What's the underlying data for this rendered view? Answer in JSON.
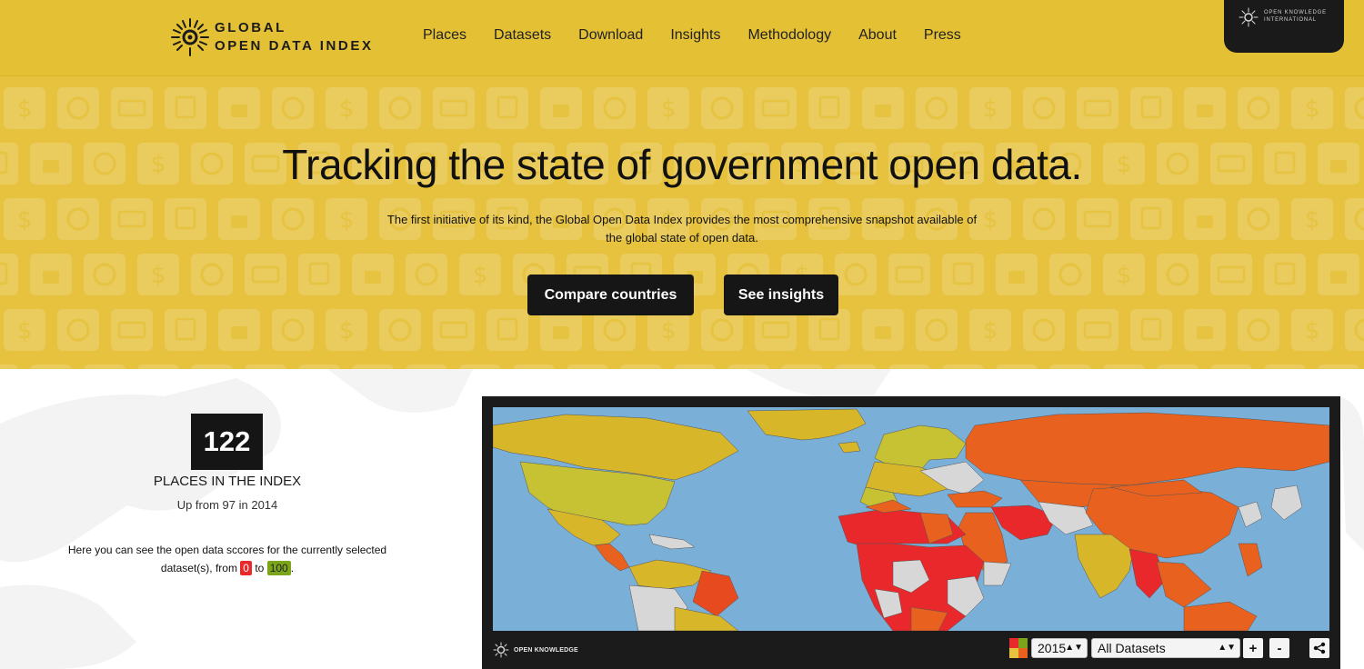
{
  "brand": {
    "line1": "GLOBAL",
    "line2": "OPEN DATA INDEX"
  },
  "nav": {
    "items": [
      "Places",
      "Datasets",
      "Download",
      "Insights",
      "Methodology",
      "About",
      "Press"
    ]
  },
  "okfn_tab": {
    "line1": "OPEN KNOWLEDGE",
    "line2": "INTERNATIONAL"
  },
  "hero": {
    "title": "Tracking the state of government open data.",
    "subtitle_line1": "The first initiative of its kind, the Global Open Data Index provides the most comprehensive snapshot available of",
    "subtitle_line2": "the global state of open data.",
    "compare_button": "Compare countries",
    "insights_button": "See insights",
    "pattern_icons": [
      "dollar-icon",
      "download-icon",
      "keyboard-icon",
      "documents-icon",
      "lock-icon",
      "clock-icon"
    ]
  },
  "stats": {
    "count": "122",
    "label": "PLACES IN THE INDEX",
    "up_from": "Up from 97 in 2014",
    "scores_text_1": "Here you can see the open data sccores for the currently selected",
    "scores_text_2": "dataset(s), from",
    "scores_text_to": "to",
    "scores_text_end": ".",
    "min_score": "0",
    "max_score": "100"
  },
  "map_widget": {
    "brand": "OPEN KNOWLEDGE",
    "year": "2015",
    "dataset": "All Datasets",
    "zoom_in": "+",
    "zoom_out": "-",
    "share_icon": "share-icon"
  },
  "colors": {
    "hero_bg": "#e6c23e",
    "dark": "#151515",
    "ocean": "#7aafd8",
    "score_low": "#e8282b",
    "score_high": "#7ca51a"
  }
}
